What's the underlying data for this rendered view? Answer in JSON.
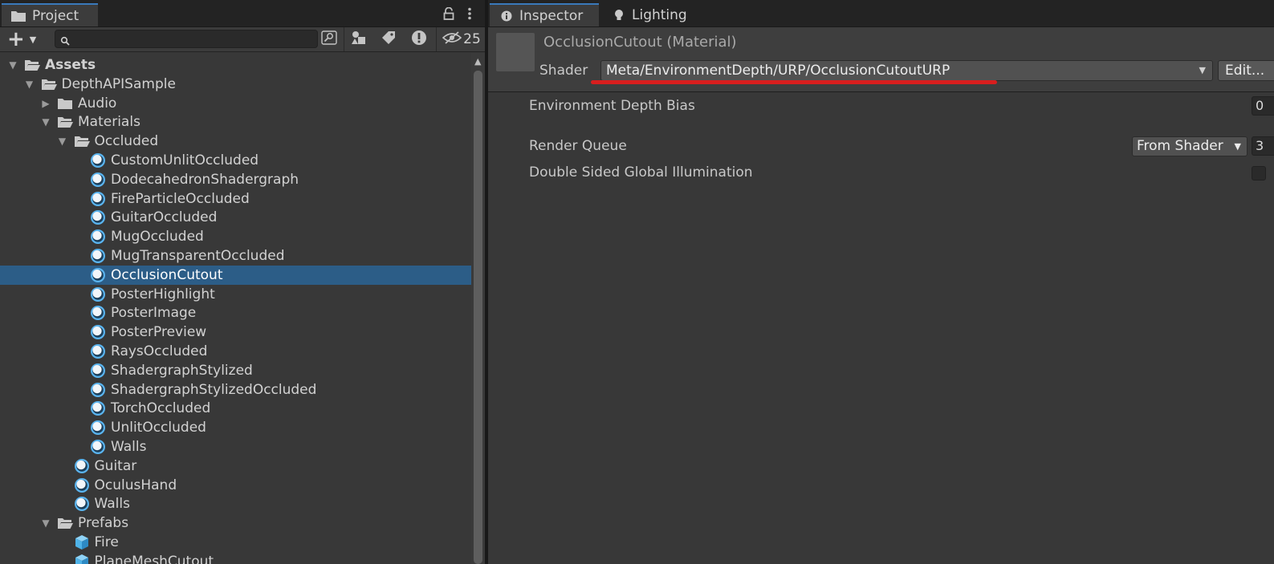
{
  "project_panel": {
    "tab_label": "Project",
    "hidden_count": "25",
    "search": {
      "value": "",
      "placeholder": ""
    },
    "tree": [
      {
        "label": "Assets",
        "depth": 0,
        "expanded": true,
        "icon": "folder-open-icon",
        "bold": true
      },
      {
        "label": "DepthAPISample",
        "depth": 1,
        "expanded": true,
        "icon": "folder-open-icon"
      },
      {
        "label": "Audio",
        "depth": 2,
        "expanded": false,
        "icon": "folder-icon"
      },
      {
        "label": "Materials",
        "depth": 2,
        "expanded": true,
        "icon": "folder-open-icon"
      },
      {
        "label": "Occluded",
        "depth": 3,
        "expanded": true,
        "icon": "folder-open-icon"
      },
      {
        "label": "CustomUnlitOccluded",
        "depth": 4,
        "icon": "material-icon"
      },
      {
        "label": "DodecahedronShadergraph",
        "depth": 4,
        "icon": "material-icon"
      },
      {
        "label": "FireParticleOccluded",
        "depth": 4,
        "icon": "material-icon"
      },
      {
        "label": "GuitarOccluded",
        "depth": 4,
        "icon": "material-icon"
      },
      {
        "label": "MugOccluded",
        "depth": 4,
        "icon": "material-icon"
      },
      {
        "label": "MugTransparentOccluded",
        "depth": 4,
        "icon": "material-icon"
      },
      {
        "label": "OcclusionCutout",
        "depth": 4,
        "icon": "material-icon",
        "selected": true
      },
      {
        "label": "PosterHighlight",
        "depth": 4,
        "icon": "material-icon"
      },
      {
        "label": "PosterImage",
        "depth": 4,
        "icon": "material-icon"
      },
      {
        "label": "PosterPreview",
        "depth": 4,
        "icon": "material-icon"
      },
      {
        "label": "RaysOccluded",
        "depth": 4,
        "icon": "material-icon"
      },
      {
        "label": "ShadergraphStylized",
        "depth": 4,
        "icon": "material-icon"
      },
      {
        "label": "ShadergraphStylizedOccluded",
        "depth": 4,
        "icon": "material-icon"
      },
      {
        "label": "TorchOccluded",
        "depth": 4,
        "icon": "material-icon"
      },
      {
        "label": "UnlitOccluded",
        "depth": 4,
        "icon": "material-icon"
      },
      {
        "label": "Walls",
        "depth": 4,
        "icon": "material-icon"
      },
      {
        "label": "Guitar",
        "depth": 3,
        "icon": "material-icon"
      },
      {
        "label": "OculusHand",
        "depth": 3,
        "icon": "material-icon"
      },
      {
        "label": "Walls",
        "depth": 3,
        "icon": "material-icon"
      },
      {
        "label": "Prefabs",
        "depth": 2,
        "expanded": true,
        "icon": "folder-open-icon"
      },
      {
        "label": "Fire",
        "depth": 3,
        "icon": "prefab-icon"
      },
      {
        "label": "PlaneMeshCutout",
        "depth": 3,
        "icon": "prefab-icon"
      }
    ]
  },
  "inspector": {
    "tabs": [
      {
        "label": "Inspector",
        "icon": "info-icon",
        "active": true
      },
      {
        "label": "Lighting",
        "icon": "lightbulb-icon",
        "active": false
      }
    ],
    "material_title": "OcclusionCutout (Material)",
    "shader_label": "Shader",
    "shader_value": "Meta/EnvironmentDepth/URP/OcclusionCutoutURP",
    "edit_label": "Edit...",
    "properties": {
      "depth_bias_label": "Environment Depth Bias",
      "depth_bias_value": "0",
      "render_queue_label": "Render Queue",
      "render_queue_mode": "From Shader",
      "render_queue_value": "3",
      "double_sided_gi_label": "Double Sided Global Illumination",
      "double_sided_gi_checked": false
    }
  },
  "colors": {
    "selection": "#2c5d87",
    "material_icon": "#5ab4ef",
    "prefab_icon": "#4fb3e8",
    "shader_underline": "#d81e1e",
    "tab_accent": "#3a79bb"
  }
}
